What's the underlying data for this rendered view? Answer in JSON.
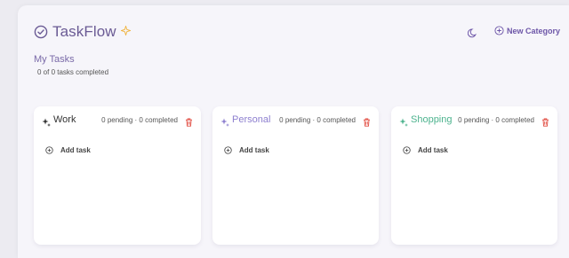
{
  "app": {
    "title": "TaskFlow"
  },
  "header": {
    "new_category_label": "New Category"
  },
  "section": {
    "title": "My Tasks",
    "subtitle": "0 of 0 tasks completed"
  },
  "categories": [
    {
      "name": "Work",
      "stats": "0 pending · 0 completed",
      "color": "#333333",
      "add_label": "Add task"
    },
    {
      "name": "Personal",
      "stats": "0 pending · 0 completed",
      "color": "#8d7fcf",
      "add_label": "Add task"
    },
    {
      "name": "Shopping",
      "stats": "0 pending · 0 completed",
      "color": "#4db38e",
      "add_label": "Add task"
    }
  ],
  "colors": {
    "brand": "#6a5a94",
    "accent": "#6d56a8",
    "star": "#f0b440",
    "danger": "#e0473c"
  },
  "icons": [
    "check-circle-icon",
    "sparkle-icon",
    "moon-icon",
    "plus-circle-icon",
    "trash-icon"
  ]
}
